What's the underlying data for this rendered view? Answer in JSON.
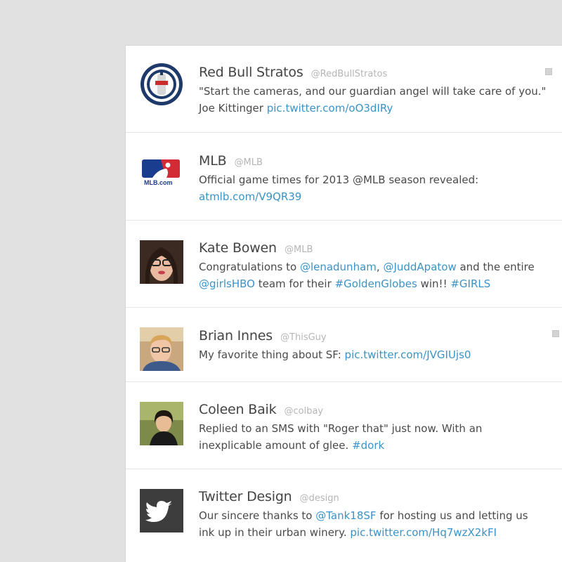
{
  "colors": {
    "background": "#e1e1e1",
    "card": "#ffffff",
    "name": "#444444",
    "handle": "#b5b5b5",
    "text": "#4a4a4a",
    "link": "#3a93c8"
  },
  "tweets": [
    {
      "name": "Red Bull Stratos",
      "handle": "@RedBullStratos",
      "avatar": "red-bull-stratos-logo",
      "line1": "\"Start the cameras, and our guardian angel will take care of you.\"",
      "line2_text": "Joe Kittinger ",
      "line2_link": "pic.twitter.com/oO3dIRy"
    },
    {
      "name": "MLB",
      "handle": "@MLB",
      "avatar": "mlb-logo",
      "avatar_text": "MLB.com",
      "line1": "Official game times for 2013 @MLB season revealed:",
      "line2_link": "atmlb.com/V9QR39"
    },
    {
      "name": "Kate Bowen",
      "handle": "@MLB",
      "avatar": "kate-bowen-photo",
      "line1_a": "Congratulations to ",
      "line1_link1": "@lenadunham",
      "line1_b": ", ",
      "line1_link2": "@JuddApatow",
      "line1_c": " and the entire",
      "line2_link1": "@girlsHBO",
      "line2_a": " team for their ",
      "line2_link2": "#GoldenGlobes",
      "line2_b": " win!! ",
      "line2_link3": "#GIRLS"
    },
    {
      "name": "Brian Innes",
      "handle": "@ThisGuy",
      "avatar": "brian-innes-photo",
      "line1_text": "My favorite thing about SF: ",
      "line1_link": "pic.twitter.com/JVGIUjs0"
    },
    {
      "name": "Coleen Baik",
      "handle": "@colbay",
      "avatar": "coleen-baik-photo",
      "line1": "Replied to an SMS with \"Roger that\" just now. With an",
      "line2_text": "inexplicable amount of glee. ",
      "line2_link": "#dork"
    },
    {
      "name": "Twitter Design",
      "handle": "@design",
      "avatar": "twitter-bird-logo",
      "line1_a": "Our sincere thanks to ",
      "line1_link": "@Tank18SF",
      "line1_b": " for hosting us and letting us",
      "line2_text": "ink up in their urban winery. ",
      "line2_link": "pic.twitter.com/Hq7wzX2kFI"
    }
  ]
}
